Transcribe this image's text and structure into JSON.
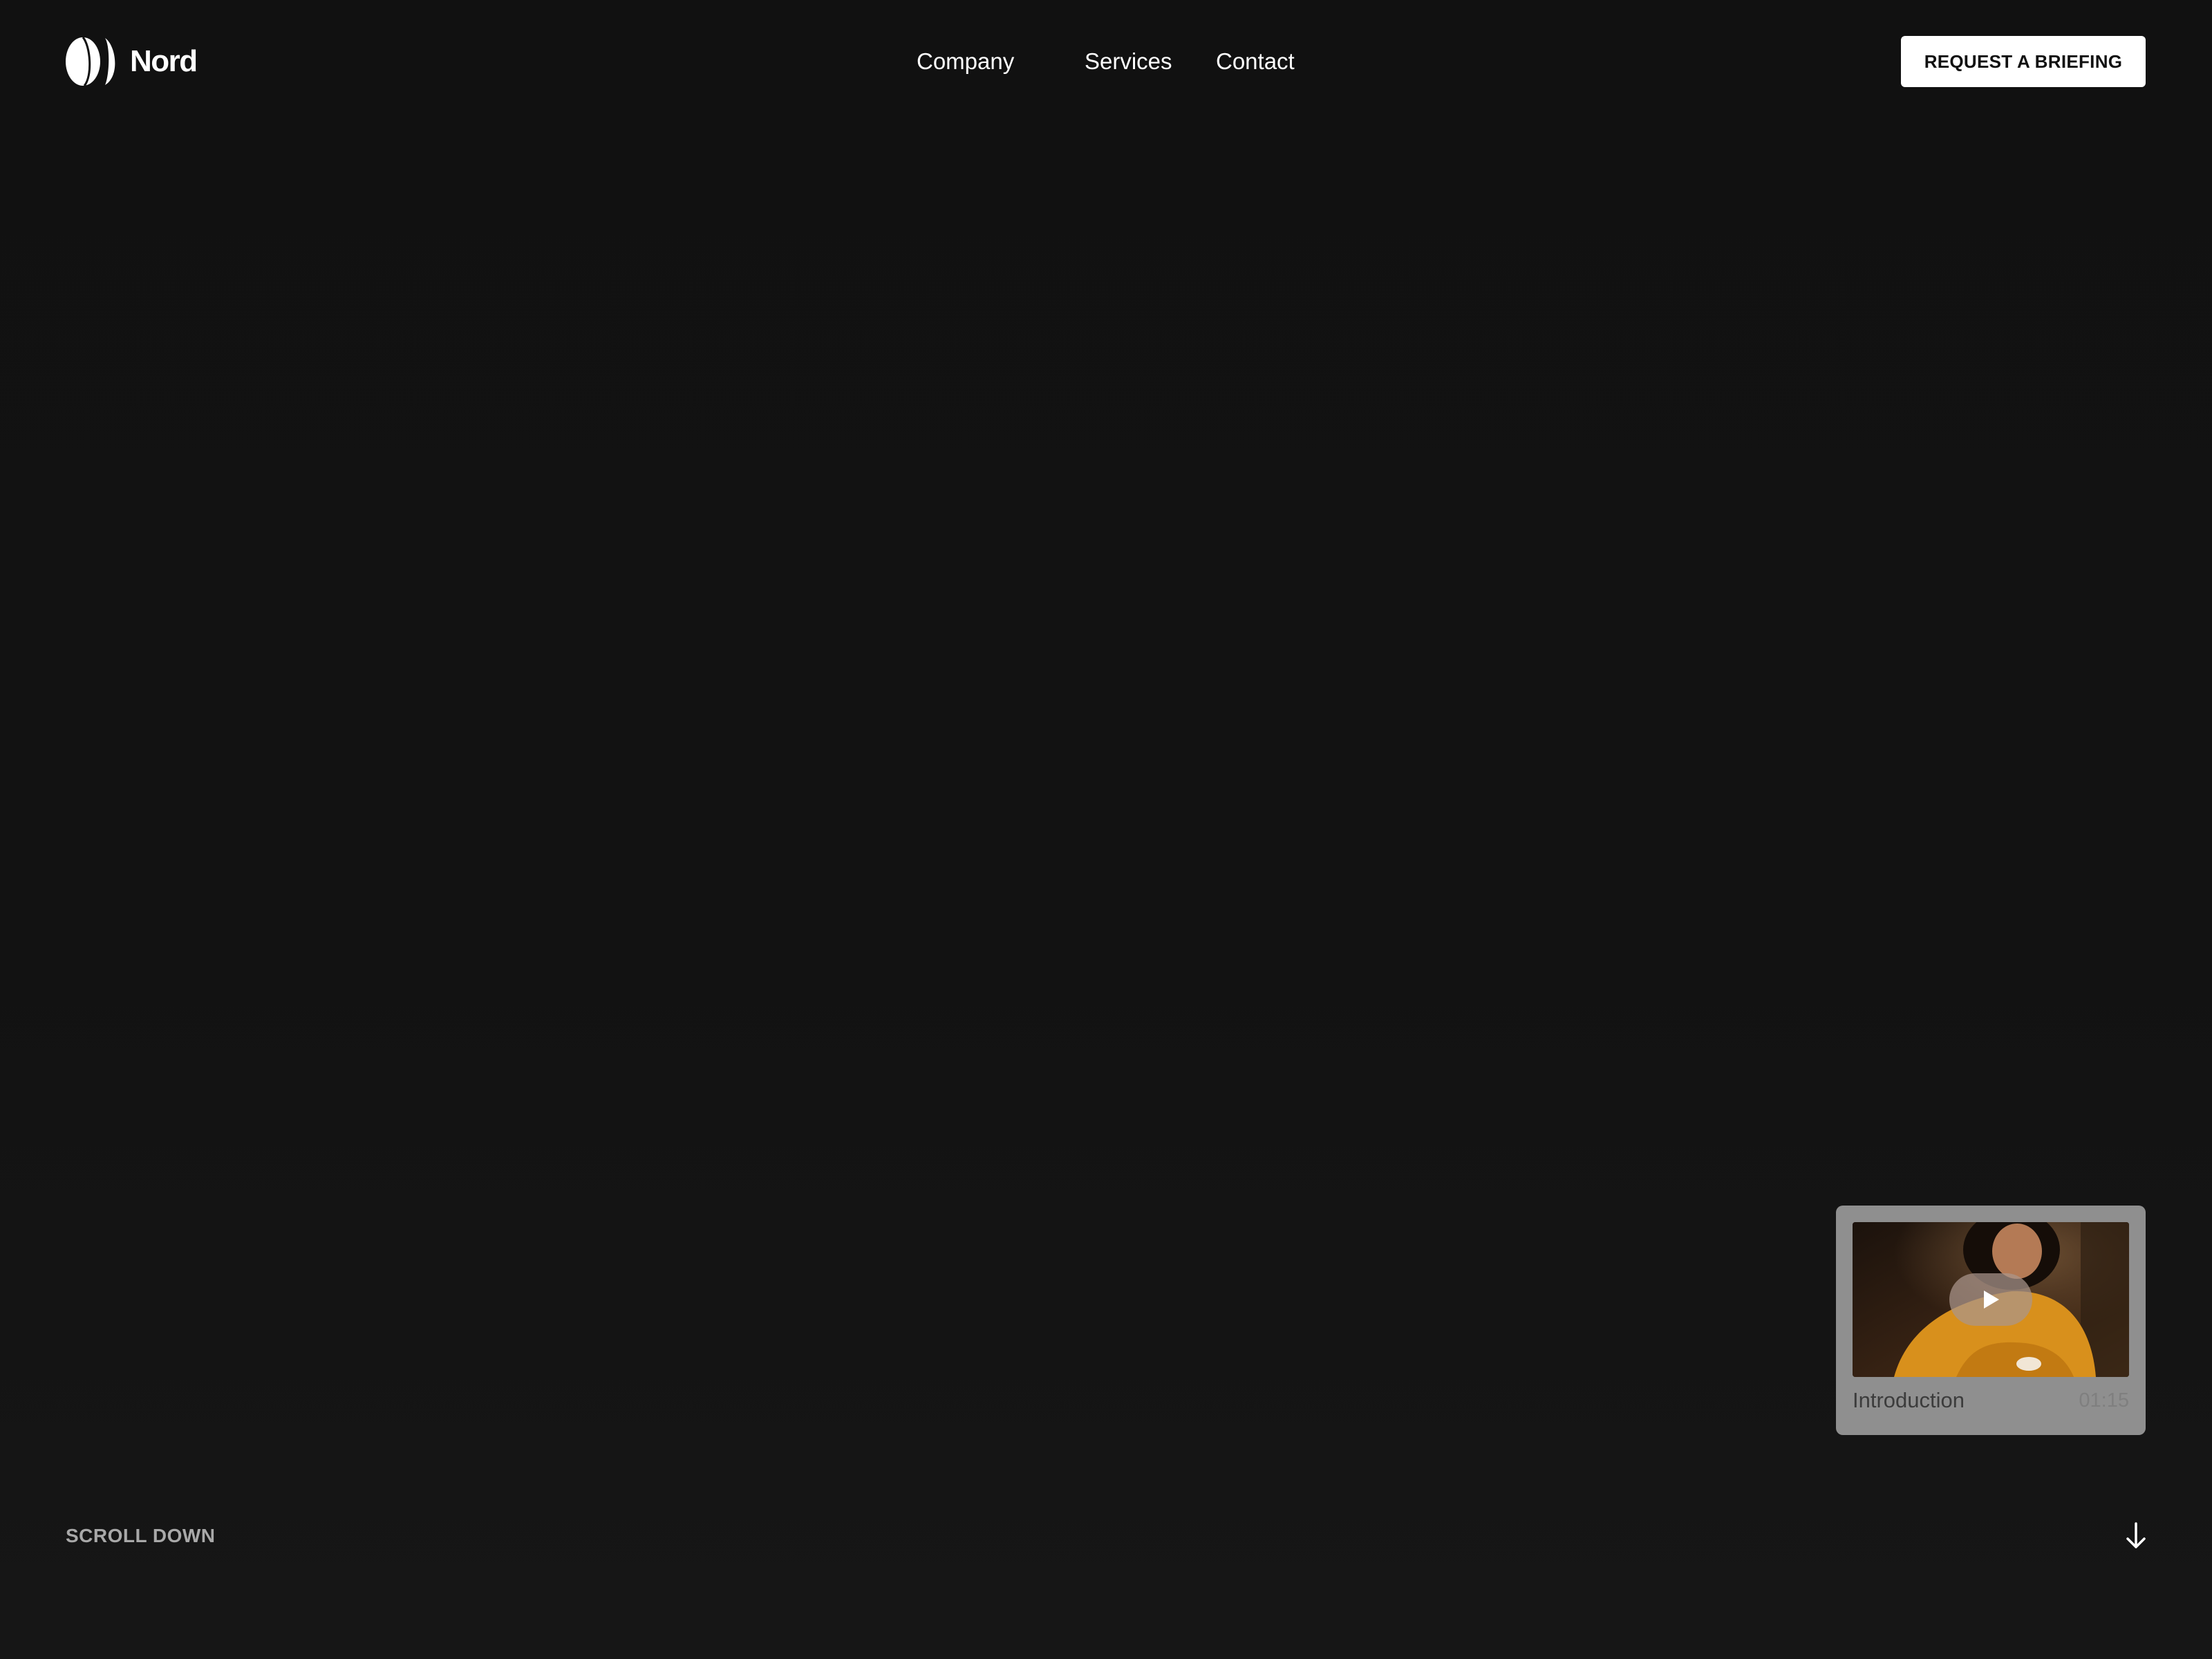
{
  "header": {
    "brand": "Nord",
    "logo_icon": "half-moon-logo-icon",
    "nav": [
      {
        "label": "Company"
      },
      {
        "label": "Services"
      },
      {
        "label": "Contact"
      }
    ],
    "cta_label": "REQUEST A BRIEFING"
  },
  "video_card": {
    "title": "Introduction",
    "duration": "01:15",
    "play_icon": "play-icon"
  },
  "footer": {
    "scroll_label": "SCROLL DOWN",
    "scroll_icon": "arrow-down-icon"
  },
  "colors": {
    "background": "#111111",
    "cta_background": "#ffffff",
    "card_background": "#8f8f8f",
    "thumbnail_accent": "#d8901c"
  }
}
